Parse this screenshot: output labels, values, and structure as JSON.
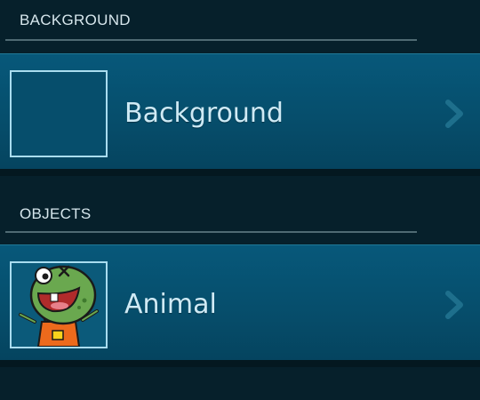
{
  "sections": [
    {
      "title": "BACKGROUND",
      "items": [
        {
          "label": "Background",
          "thumbnail_icon": "empty-square-thumbnail",
          "chevron_icon": "chevron-right-icon"
        }
      ]
    },
    {
      "title": "OBJECTS",
      "items": [
        {
          "label": "Animal",
          "thumbnail_icon": "cartoon-monster-thumbnail",
          "chevron_icon": "chevron-right-icon"
        }
      ]
    }
  ],
  "colors": {
    "background": "#06202b",
    "list_item": "#064e6c",
    "thumb_border": "#a9dcef",
    "label_text": "#cfeaf5",
    "section_text": "#d6e6ec",
    "divider": "#4f6a73",
    "chevron": "#1e6f8c"
  }
}
